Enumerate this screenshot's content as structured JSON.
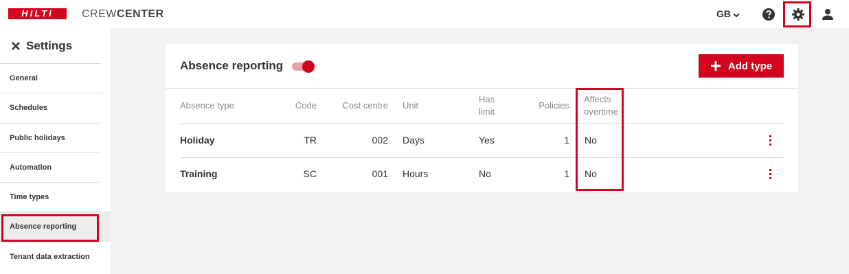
{
  "header": {
    "logo_text": "HILTI",
    "app_name_light": "CREW",
    "app_name_bold": "CENTER",
    "language": "GB",
    "icons": [
      "help-icon",
      "gear-icon",
      "user-icon",
      "chevron-down-icon"
    ]
  },
  "sidebar": {
    "title": "Settings",
    "close_icon": "close-icon",
    "items": [
      {
        "label": "General"
      },
      {
        "label": "Schedules"
      },
      {
        "label": "Public holidays"
      },
      {
        "label": "Automation"
      },
      {
        "label": "Time types"
      },
      {
        "label": "Absence reporting"
      },
      {
        "label": "Tenant data extraction"
      }
    ],
    "active_item": "Absence reporting"
  },
  "card": {
    "title": "Absence reporting",
    "toggle_on": true,
    "add_button_label": "Add type",
    "add_icon": "plus-icon",
    "columns": {
      "absence_type": "Absence type",
      "code": "Code",
      "cost_centre": "Cost centre",
      "unit": "Unit",
      "has_limit_1": "Has",
      "has_limit_2": "limit",
      "policies": "Policies",
      "affects_overtime_1": "Affects",
      "affects_overtime_2": "overtime"
    },
    "rows": [
      {
        "name": "Holiday",
        "code": "TR",
        "cost_centre": "002",
        "unit": "Days",
        "has_limit": "Yes",
        "policies": "1",
        "affects_overtime": "No"
      },
      {
        "name": "Training",
        "code": "SC",
        "cost_centre": "001",
        "unit": "Hours",
        "has_limit": "No",
        "policies": "1",
        "affects_overtime": "No"
      }
    ]
  },
  "colors": {
    "brand_red": "#d2051e",
    "background": "#f3f2f2"
  }
}
